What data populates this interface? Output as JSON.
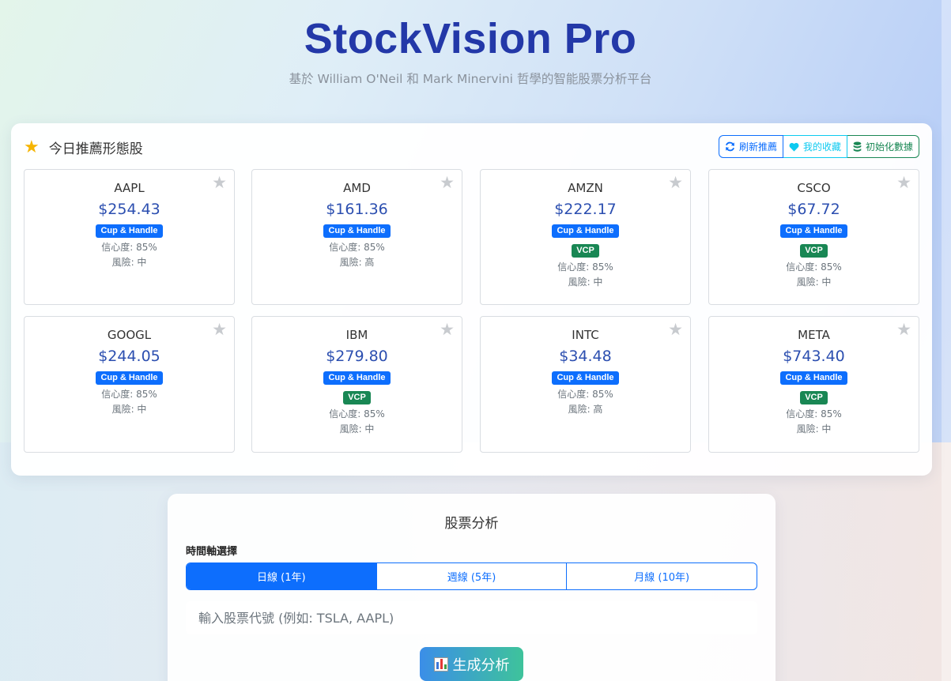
{
  "header": {
    "title": "StockVision Pro",
    "subtitle": "基於 William O'Neil 和 Mark Minervini 哲學的智能股票分析平台"
  },
  "recommend": {
    "title": "今日推薦形態股",
    "buttons": {
      "refresh": "刷新推薦",
      "favorites": "我的收藏",
      "init": "初始化數據"
    },
    "stocks": [
      {
        "symbol": "AAPL",
        "price": "$254.43",
        "patterns": [
          "Cup & Handle"
        ],
        "confidence": "信心度: 85%",
        "risk": "風險: 中"
      },
      {
        "symbol": "AMD",
        "price": "$161.36",
        "patterns": [
          "Cup & Handle"
        ],
        "confidence": "信心度: 85%",
        "risk": "風險: 高"
      },
      {
        "symbol": "AMZN",
        "price": "$222.17",
        "patterns": [
          "Cup & Handle",
          "VCP"
        ],
        "confidence": "信心度: 85%",
        "risk": "風險: 中"
      },
      {
        "symbol": "CSCO",
        "price": "$67.72",
        "patterns": [
          "Cup & Handle",
          "VCP"
        ],
        "confidence": "信心度: 85%",
        "risk": "風險: 中"
      },
      {
        "symbol": "GOOGL",
        "price": "$244.05",
        "patterns": [
          "Cup & Handle"
        ],
        "confidence": "信心度: 85%",
        "risk": "風險: 中"
      },
      {
        "symbol": "IBM",
        "price": "$279.80",
        "patterns": [
          "Cup & Handle",
          "VCP"
        ],
        "confidence": "信心度: 85%",
        "risk": "風險: 中"
      },
      {
        "symbol": "INTC",
        "price": "$34.48",
        "patterns": [
          "Cup & Handle"
        ],
        "confidence": "信心度: 85%",
        "risk": "風險: 高"
      },
      {
        "symbol": "META",
        "price": "$743.40",
        "patterns": [
          "Cup & Handle",
          "VCP"
        ],
        "confidence": "信心度: 85%",
        "risk": "風險: 中"
      }
    ]
  },
  "analysis": {
    "title": "股票分析",
    "timeframe_label": "時間軸選擇",
    "timeframes": [
      "日線 (1年)",
      "週線 (5年)",
      "月線 (10年)"
    ],
    "active_timeframe": 0,
    "input_placeholder": "輸入股票代號 (例如: TSLA, AAPL)",
    "input_value": "",
    "generate_label": "生成分析"
  },
  "icons": {
    "recommend": "star-icon",
    "favorite": "star-outline-icon",
    "refresh": "refresh-icon",
    "favorites": "heart-icon",
    "init": "database-icon",
    "generate": "bar-chart-icon"
  },
  "colors": {
    "title": "#2338a8",
    "price": "#2c4fb0",
    "cup_badge": "#0d6efd",
    "vcp_badge": "#198754",
    "accent": "#0d6efd"
  }
}
